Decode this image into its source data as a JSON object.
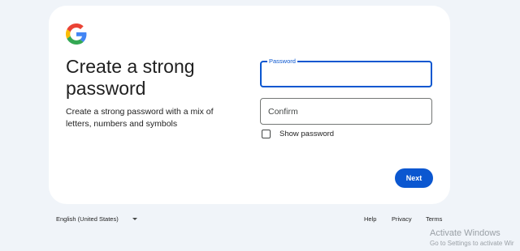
{
  "card": {
    "logo_icon": "google-g-logo",
    "headline": "Create a strong password",
    "subtext": "Create a strong password with a mix of letters, numbers and symbols"
  },
  "form": {
    "password_label": "Password",
    "password_value": "",
    "confirm_placeholder": "Confirm",
    "confirm_value": "",
    "show_password_label": "Show password",
    "show_password_checked": false
  },
  "actions": {
    "next_label": "Next"
  },
  "colors": {
    "accent": "#0b57d0",
    "background": "#f0f4f9",
    "card": "#ffffff"
  },
  "footer": {
    "language": "English (United States)",
    "links": [
      "Help",
      "Privacy",
      "Terms"
    ]
  },
  "watermark": {
    "line1": "Activate Windows",
    "line2": "Go to Settings to activate Wir"
  }
}
